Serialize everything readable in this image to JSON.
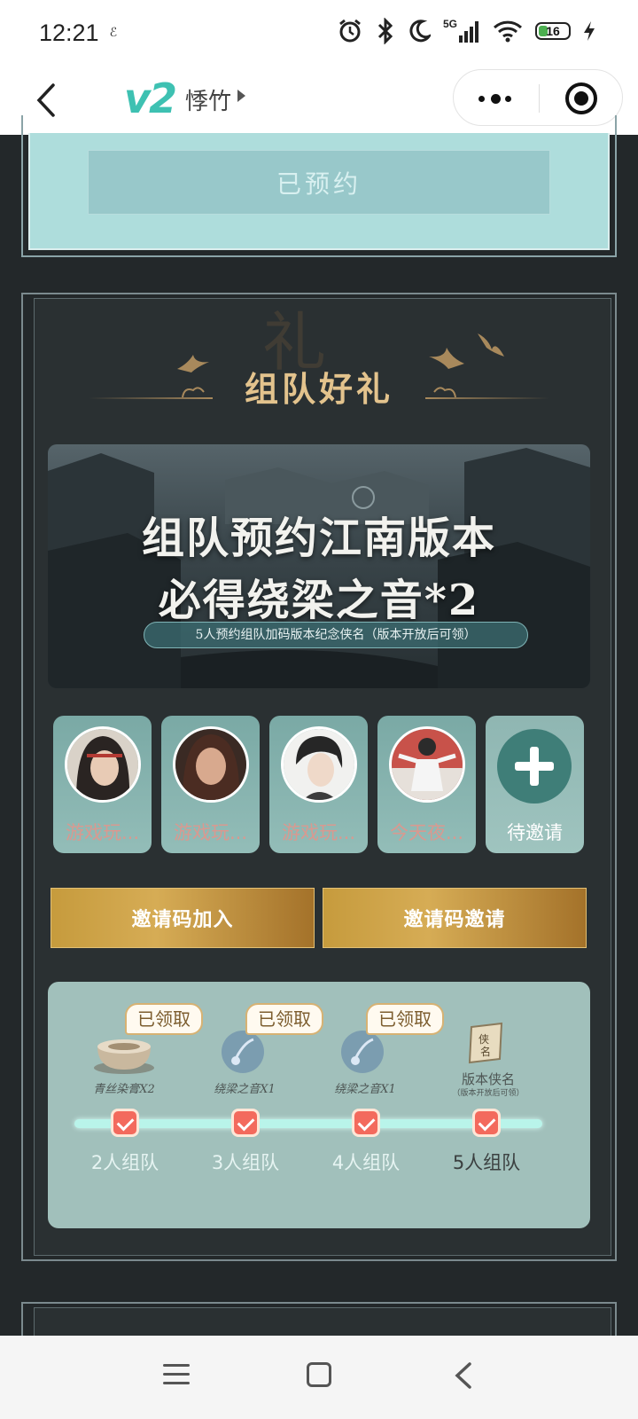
{
  "status_bar": {
    "time": "12:21",
    "extra": "ℰ",
    "network": "5G",
    "battery": "16"
  },
  "nav": {
    "logo": "v2",
    "title": "悸竹"
  },
  "reservation": {
    "button_label": "已预约"
  },
  "team_gift": {
    "title": "组队好礼",
    "banner": {
      "line1": "组队预约江南版本",
      "line2": "必得绕梁之音*2",
      "subtitle": "5人预约组队加码版本纪念侠名（版本开放后可领）"
    },
    "members": [
      {
        "name": "游戏玩..."
      },
      {
        "name": "游戏玩..."
      },
      {
        "name": "游戏玩..."
      },
      {
        "name": "今天夜..."
      }
    ],
    "invite_slot": {
      "label": "待邀请"
    },
    "buttons": {
      "join_by_code": "邀请码加入",
      "invite_by_code": "邀请码邀请"
    },
    "rewards": [
      {
        "label": "青丝染膏X2",
        "claimed": "已领取",
        "tier": "2人组队"
      },
      {
        "label": "绕梁之音X1",
        "claimed": "已领取",
        "tier": "3人组队"
      },
      {
        "label": "绕梁之音X1",
        "claimed": "已领取",
        "tier": "4人组队"
      },
      {
        "label": "版本侠名",
        "note": "（版本开放后可领）",
        "tier": "5人组队"
      }
    ]
  },
  "colors": {
    "accent_teal": "#aedddc",
    "gold": "#d6ac55",
    "title_gold": "#e3c38d",
    "progress_node": "#f36a5d"
  }
}
